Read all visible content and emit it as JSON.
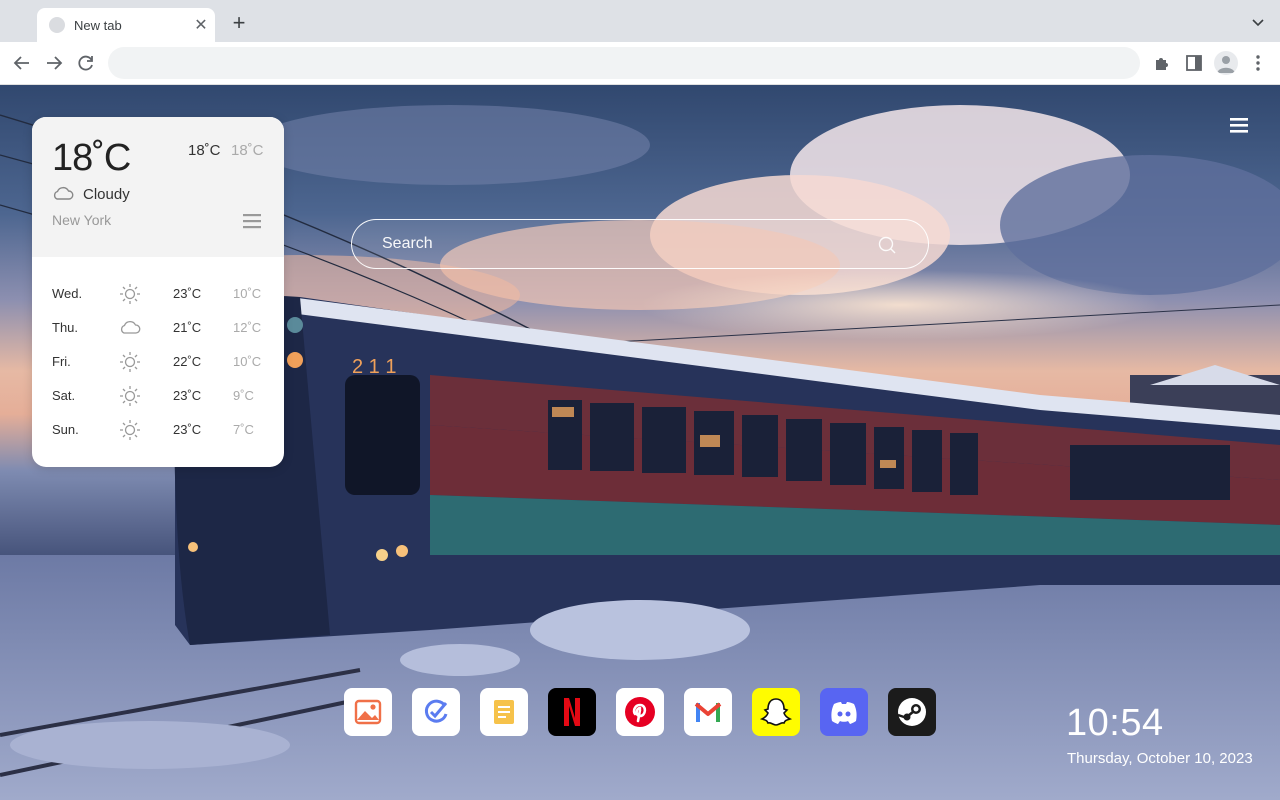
{
  "browser": {
    "tab": {
      "title": "New tab"
    },
    "omnibox": {
      "value": "",
      "placeholder": ""
    }
  },
  "search": {
    "placeholder": "Search"
  },
  "weather": {
    "current_temp": "18˚C",
    "high": "18˚C",
    "low": "18˚C",
    "condition": "Cloudy",
    "condition_icon": "cloud-icon",
    "city": "New York",
    "forecast": [
      {
        "day": "Wed.",
        "icon": "sun-icon",
        "high": "23˚C",
        "low": "10˚C"
      },
      {
        "day": "Thu.",
        "icon": "cloud-icon",
        "high": "21˚C",
        "low": "12˚C"
      },
      {
        "day": "Fri.",
        "icon": "sun-icon",
        "high": "22˚C",
        "low": "10˚C"
      },
      {
        "day": "Sat.",
        "icon": "sun-icon",
        "high": "23˚C",
        "low": "9˚C"
      },
      {
        "day": "Sun.",
        "icon": "sun-icon",
        "high": "23˚C",
        "low": "7˚C"
      }
    ]
  },
  "dock": [
    {
      "name": "photos",
      "icon": "image-icon",
      "color": "#ffffff"
    },
    {
      "name": "tasks",
      "icon": "check-circle-icon",
      "color": "#ffffff"
    },
    {
      "name": "notes",
      "icon": "note-icon",
      "color": "#ffffff"
    },
    {
      "name": "netflix",
      "icon": "netflix-icon",
      "color": "#000000"
    },
    {
      "name": "pinterest",
      "icon": "pinterest-icon",
      "color": "#ffffff"
    },
    {
      "name": "gmail",
      "icon": "gmail-icon",
      "color": "#ffffff"
    },
    {
      "name": "snapchat",
      "icon": "snapchat-icon",
      "color": "#fffc00"
    },
    {
      "name": "discord",
      "icon": "discord-icon",
      "color": "#5865f2"
    },
    {
      "name": "steam",
      "icon": "steam-icon",
      "color": "#1b1b1b"
    }
  ],
  "clock": {
    "time": "10:54",
    "date": "Thursday, October 10, 2023"
  }
}
